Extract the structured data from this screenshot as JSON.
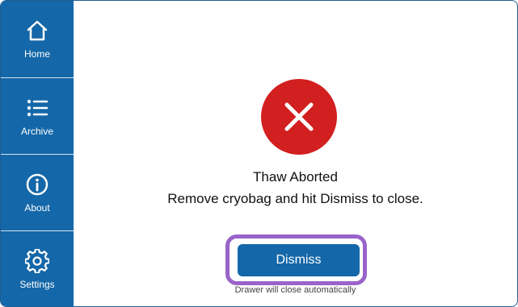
{
  "sidebar": {
    "items": [
      {
        "label": "Home",
        "icon": "home-icon"
      },
      {
        "label": "Archive",
        "icon": "list-icon"
      },
      {
        "label": "About",
        "icon": "info-icon"
      },
      {
        "label": "Settings",
        "icon": "gear-icon"
      }
    ]
  },
  "dialog": {
    "icon": "error-x-icon",
    "title": "Thaw Aborted",
    "message": "Remove cryobag and hit Dismiss to close.",
    "dismiss_label": "Dismiss",
    "footnote": "Drawer will close automatically"
  },
  "colors": {
    "sidebar_bg": "#1467a8",
    "error_red": "#d21f1f",
    "highlight_purple": "#9a63c9",
    "button_blue": "#1467a8"
  }
}
